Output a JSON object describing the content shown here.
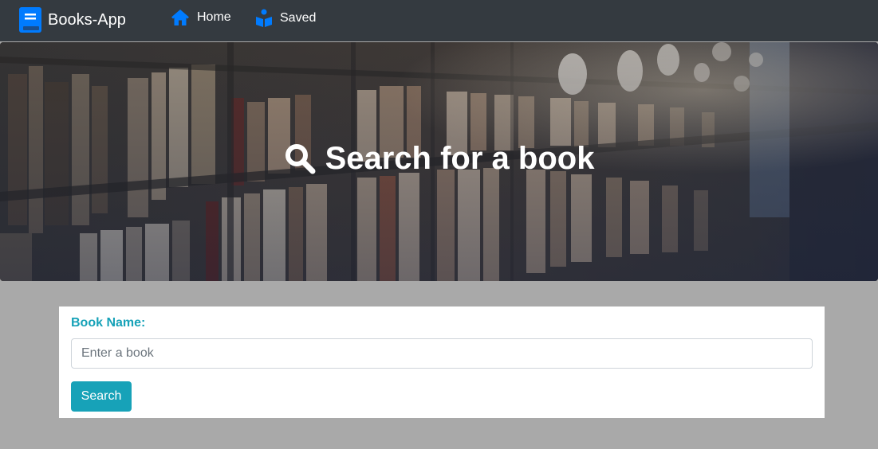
{
  "navbar": {
    "brand": "Books-App",
    "links": [
      {
        "label": "Home",
        "icon": "home-icon"
      },
      {
        "label": "Saved",
        "icon": "reader-icon"
      }
    ]
  },
  "hero": {
    "title": "Search for a book",
    "icon": "search-icon"
  },
  "search_form": {
    "label": "Book Name:",
    "placeholder": "Enter a book",
    "value": "",
    "button_label": "Search"
  },
  "colors": {
    "navbar_bg": "#343a40",
    "accent": "#17a2b8",
    "brand_icon": "#007bff",
    "page_bg": "#a9a9a9"
  }
}
